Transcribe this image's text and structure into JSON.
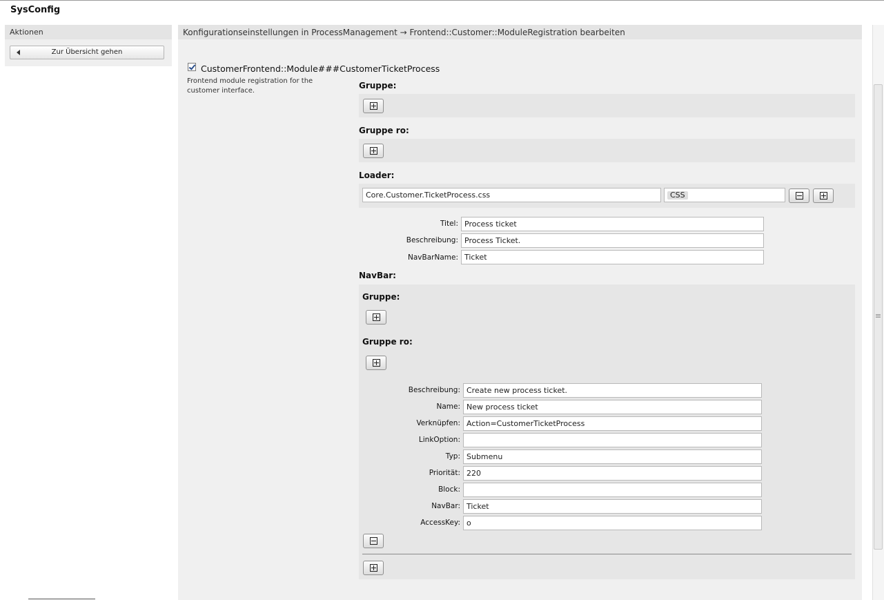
{
  "app": {
    "title": "SysConfig"
  },
  "sidebar": {
    "header": "Aktionen",
    "back_button": "Zur Übersicht gehen"
  },
  "main": {
    "header": "Konfigurationseinstellungen in ProcessManagement → Frontend::Customer::ModuleRegistration bearbeiten",
    "setting": {
      "name": "CustomerFrontend::Module###CustomerTicketProcess",
      "enabled": true,
      "description": "Frontend module registration for the customer interface."
    },
    "labels": {
      "gruppe": "Gruppe:",
      "gruppe_ro": "Gruppe ro:",
      "loader": "Loader:",
      "navbar": "NavBar:"
    },
    "loader": {
      "value": "Core.Customer.TicketProcess.css",
      "type": "CSS"
    },
    "fields": {
      "titel_label": "Titel:",
      "titel_value": "Process ticket",
      "beschreibung_label": "Beschreibung:",
      "beschreibung_value": "Process Ticket.",
      "navbarname_label": "NavBarName:",
      "navbarname_value": "Ticket"
    },
    "navbar": {
      "gruppe_label": "Gruppe:",
      "gruppe_ro_label": "Gruppe ro:",
      "fields": [
        {
          "label": "Beschreibung:",
          "value": "Create new process ticket."
        },
        {
          "label": "Name:",
          "value": "New process ticket"
        },
        {
          "label": "Verknüpfen:",
          "value": "Action=CustomerTicketProcess"
        },
        {
          "label": "LinkOption:",
          "value": ""
        },
        {
          "label": "Typ:",
          "value": "Submenu"
        },
        {
          "label": "Priorität:",
          "value": "220"
        },
        {
          "label": "Block:",
          "value": ""
        },
        {
          "label": "NavBar:",
          "value": "Ticket"
        },
        {
          "label": "AccessKey:",
          "value": "o"
        }
      ]
    }
  },
  "icons": {
    "add": "plus-square-icon",
    "remove": "minus-square-icon",
    "back": "triangle-left-icon"
  }
}
